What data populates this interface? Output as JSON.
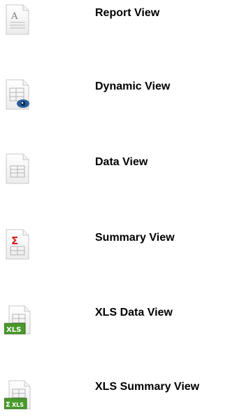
{
  "views": [
    {
      "label": "Report View",
      "icon": "report-view-icon"
    },
    {
      "label": "Dynamic View",
      "icon": "dynamic-view-icon"
    },
    {
      "label": "Data View",
      "icon": "data-view-icon"
    },
    {
      "label": "Summary View",
      "icon": "summary-view-icon"
    },
    {
      "label": "XLS Data View",
      "icon": "xls-data-view-icon"
    },
    {
      "label": "XLS Summary View",
      "icon": "xls-summary-view-icon"
    }
  ],
  "colors": {
    "text": "#000000",
    "page_border": "#c8c8c8",
    "grid": "#b4b4b4",
    "eye_blue": "#1f4e8c",
    "sigma_red": "#d42020",
    "xls_green": "#4a9a2c"
  }
}
